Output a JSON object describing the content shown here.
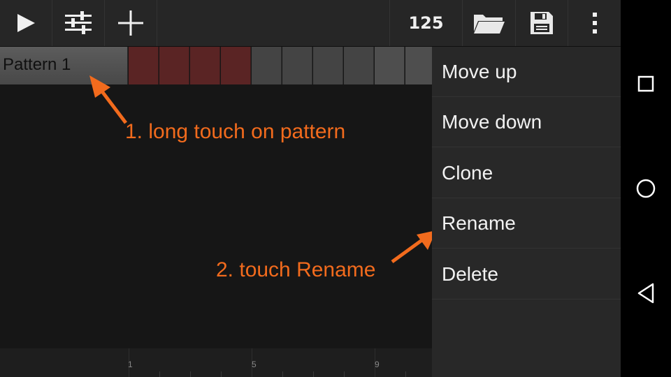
{
  "toolbar": {
    "play_icon": "play-icon",
    "mixer_icon": "sliders-icon",
    "add_icon": "plus-icon",
    "bpm": "125",
    "open_icon": "folder-icon",
    "save_icon": "save-icon",
    "overflow_icon": "more-vert-icon"
  },
  "pattern": {
    "name": "Pattern 1",
    "steps": [
      {
        "state": "on"
      },
      {
        "state": "on"
      },
      {
        "state": "on"
      },
      {
        "state": "on"
      },
      {
        "state": "off"
      },
      {
        "state": "off"
      },
      {
        "state": "off"
      },
      {
        "state": "off"
      },
      {
        "state": "off"
      },
      {
        "state": "off"
      }
    ]
  },
  "ruler": {
    "labels": [
      "1",
      "5",
      "9"
    ]
  },
  "annotations": {
    "step1": "1. long touch on pattern",
    "step2": "2. touch Rename"
  },
  "context_menu": {
    "items": [
      {
        "label": "Move up"
      },
      {
        "label": "Move down"
      },
      {
        "label": "Clone"
      },
      {
        "label": "Rename"
      },
      {
        "label": "Delete"
      }
    ]
  },
  "navbar": {
    "recents_icon": "square-icon",
    "home_icon": "circle-icon",
    "back_icon": "triangle-back-icon"
  },
  "colors": {
    "annotation": "#f26b1d",
    "step_on": "#5a2424",
    "step_off": "#444444"
  }
}
